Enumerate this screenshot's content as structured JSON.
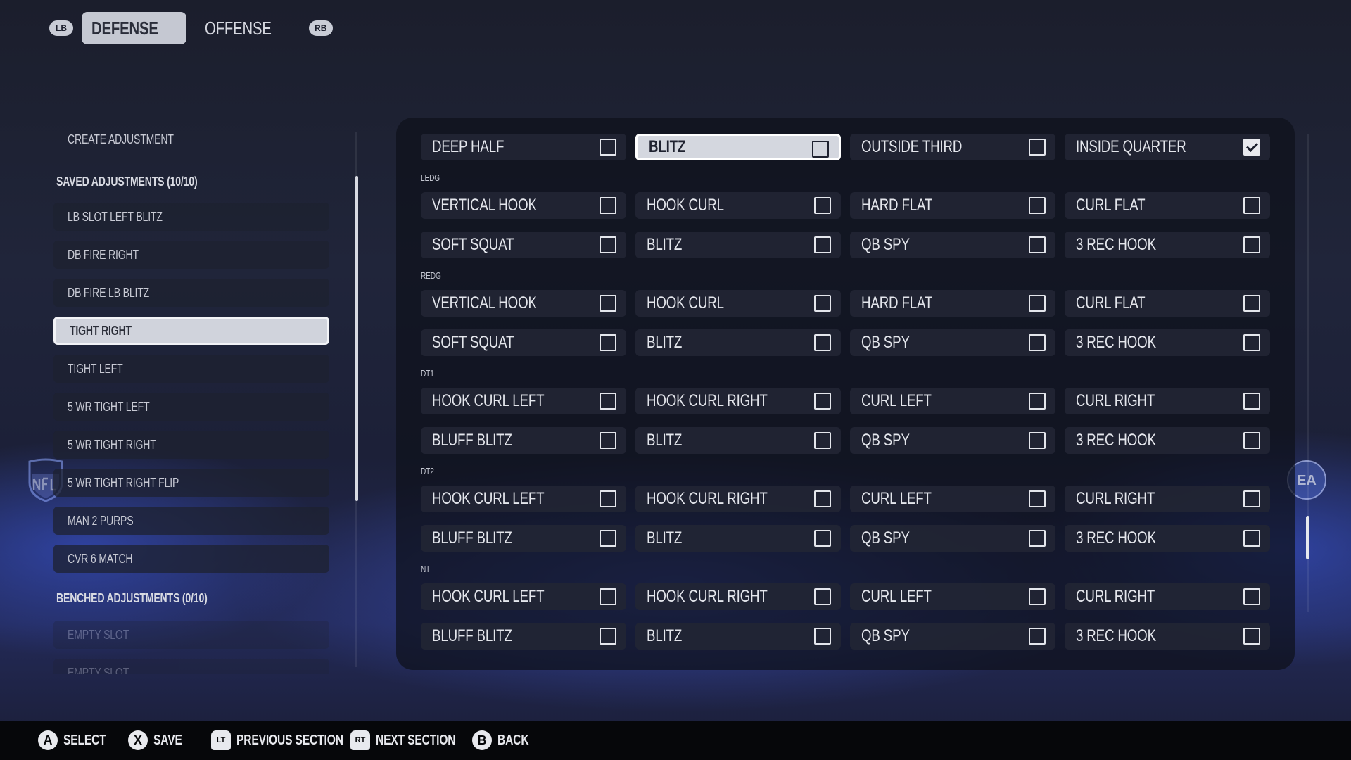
{
  "topbar": {
    "left_bumper": "LB",
    "right_bumper": "RB",
    "tabs": [
      {
        "label": "DEFENSE",
        "active": true
      },
      {
        "label": "OFFENSE",
        "active": false
      }
    ]
  },
  "sidebar": {
    "create": "CREATE ADJUSTMENT",
    "saved_header": "SAVED ADJUSTMENTS (10/10)",
    "saved": [
      "LB SLOT LEFT BLITZ",
      "DB FIRE RIGHT",
      "DB FIRE LB BLITZ",
      "TIGHT RIGHT",
      "TIGHT LEFT",
      "5 WR TIGHT LEFT",
      "5 WR TIGHT RIGHT",
      "5 WR TIGHT RIGHT FLIP",
      "MAN 2 PURPS",
      "CVR 6 MATCH"
    ],
    "selected_index": 3,
    "benched_header": "BENCHED ADJUSTMENTS (0/10)",
    "benched": [
      "EMPTY SLOT",
      "EMPTY SLOT"
    ]
  },
  "grid": {
    "top_row": [
      {
        "label": "DEEP HALF",
        "checked": false
      },
      {
        "label": "BLITZ",
        "checked": false,
        "selected": true
      },
      {
        "label": "OUTSIDE THIRD",
        "checked": false
      },
      {
        "label": "INSIDE QUARTER",
        "checked": true
      }
    ],
    "groups": [
      {
        "name": "LEDG",
        "rows": [
          [
            "VERTICAL HOOK",
            "HOOK CURL",
            "HARD FLAT",
            "CURL FLAT"
          ],
          [
            "SOFT SQUAT",
            "BLITZ",
            "QB SPY",
            "3 REC HOOK"
          ]
        ]
      },
      {
        "name": "REDG",
        "rows": [
          [
            "VERTICAL HOOK",
            "HOOK CURL",
            "HARD FLAT",
            "CURL FLAT"
          ],
          [
            "SOFT SQUAT",
            "BLITZ",
            "QB SPY",
            "3 REC HOOK"
          ]
        ]
      },
      {
        "name": "DT1",
        "rows": [
          [
            "HOOK CURL LEFT",
            "HOOK CURL RIGHT",
            "CURL LEFT",
            "CURL RIGHT"
          ],
          [
            "BLUFF BLITZ",
            "BLITZ",
            "QB SPY",
            "3 REC HOOK"
          ]
        ]
      },
      {
        "name": "DT2",
        "rows": [
          [
            "HOOK CURL LEFT",
            "HOOK CURL RIGHT",
            "CURL LEFT",
            "CURL RIGHT"
          ],
          [
            "BLUFF BLITZ",
            "BLITZ",
            "QB SPY",
            "3 REC HOOK"
          ]
        ]
      },
      {
        "name": "NT",
        "rows": [
          [
            "HOOK CURL LEFT",
            "HOOK CURL RIGHT",
            "CURL LEFT",
            "CURL RIGHT"
          ],
          [
            "BLUFF BLITZ",
            "BLITZ",
            "QB SPY",
            "3 REC HOOK"
          ]
        ]
      }
    ]
  },
  "footer": {
    "hints": [
      {
        "key": "A",
        "label": "SELECT",
        "shape": "circle"
      },
      {
        "key": "X",
        "label": "SAVE",
        "shape": "circle"
      },
      {
        "key": "LT",
        "label": "PREVIOUS SECTION",
        "shape": "trigger"
      },
      {
        "key": "RT",
        "label": "NEXT SECTION",
        "shape": "trigger"
      },
      {
        "key": "B",
        "label": "BACK",
        "shape": "circle"
      }
    ]
  },
  "logos": {
    "left": "nfl-shield-icon",
    "right": "ea-sports-icon",
    "ea_text": "EA"
  }
}
